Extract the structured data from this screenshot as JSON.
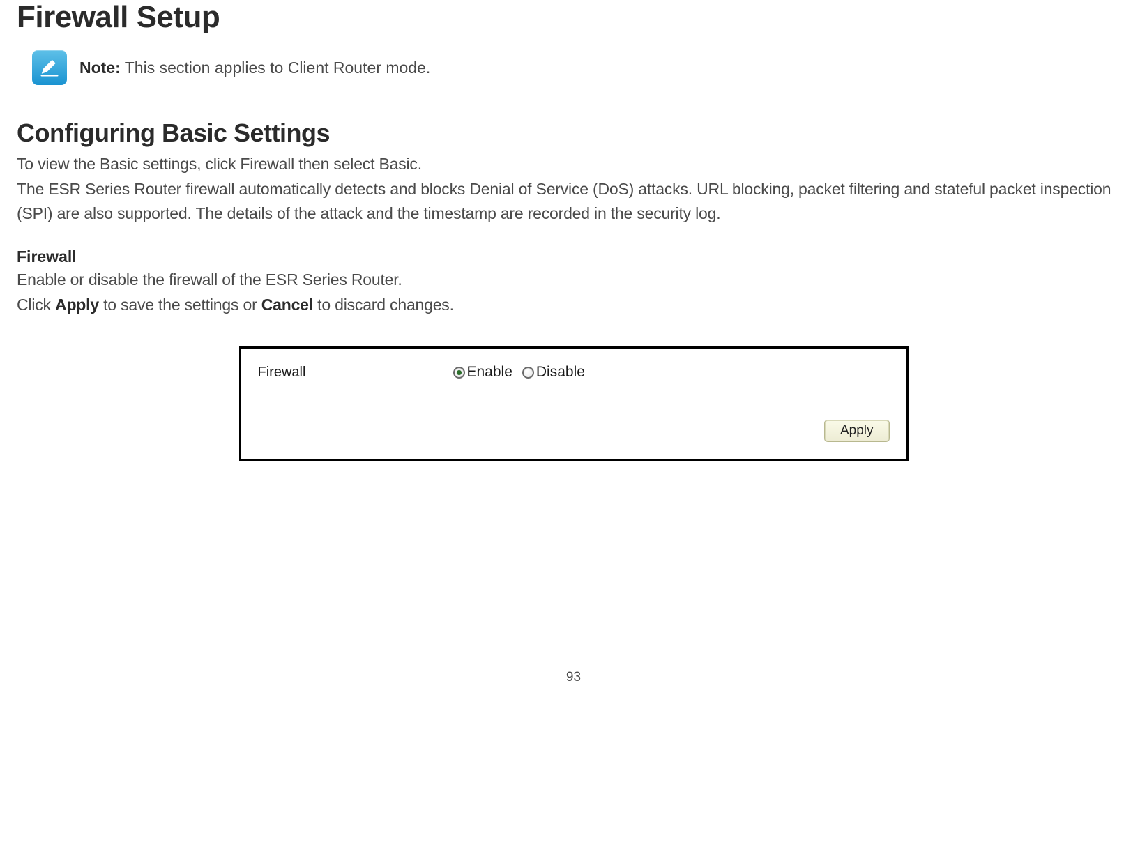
{
  "page": {
    "title": "Firewall Setup",
    "number": "93"
  },
  "note": {
    "label": "Note:",
    "text": " This section applies to Client Router mode."
  },
  "section": {
    "heading": "Configuring Basic Settings",
    "intro_line": "To view the Basic settings, click Firewall then select Basic.",
    "desc": "The ESR Series Router firewall automatically detects and blocks Denial of Service (DoS) attacks. URL blocking, packet filtering and stateful packet inspection (SPI) are also supported. The details of the attack and the timestamp are recorded in the security log.",
    "sub_heading": "Firewall",
    "sub_desc": "Enable or disable the firewall of the ESR Series Router.",
    "action_prefix": "Click ",
    "action_apply": "Apply",
    "action_mid": " to save the settings or ",
    "action_cancel": "Cancel",
    "action_suffix": " to discard changes."
  },
  "panel": {
    "label": "Firewall",
    "enable_label": "Enable",
    "disable_label": "Disable",
    "apply_button": "Apply",
    "selected": "enable"
  }
}
